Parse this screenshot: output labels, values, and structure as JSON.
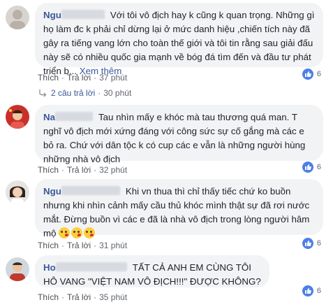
{
  "colors": {
    "link": "#385898",
    "bubble": "#f2f3f5",
    "like": "#4d7fe8",
    "meta": "#606770"
  },
  "comments": [
    {
      "name": "Ngu",
      "text": "Với tôi vô địch hay k cũng k quan trọng. Những gì họ làm đc k phải chỉ dừng lại ở mức danh hiệu ,chiến tích này đã gây ra tiếng vang lớn cho toàn thế giới và tôi tin rằng sau giải đấu này sẽ có nhiều quốc gia mạnh về bóg đá tìm đến và đầu tư phát triển b...",
      "see_more": "Xem thêm",
      "like": "Thích",
      "reply": "Trả lời",
      "time": "37 phút",
      "reaction_count": "6",
      "replies_label": "2 câu trả lời",
      "replies_time": "30 phút"
    },
    {
      "name": "Na",
      "text": "Tau nhìn mấy e khóc mà tau thương quá man. T nghĩ vô địch mới xứng đáng với công sức sự cố gắng mà các e bỏ ra. Chứ với dân tộc k có cup các e vẫn là những người hùng những nhà vô địch",
      "like": "Thích",
      "reply": "Trả lời",
      "time": "32 phút",
      "reaction_count": "6"
    },
    {
      "name": "Ngu",
      "text": "Khi vn thua thì chỉ thấy tiếc chứ ko buồn nhưng khi nhìn cảnh mấy cầu thủ khóc mình thật sự đã rơi nước mắt. Đừng buồn vì các e đã là nhà vô địch trong lòng người hâm mộ",
      "emojis": [
        "kissing-heart-emoji",
        "kissing-heart-emoji",
        "kissing-heart-emoji"
      ],
      "like": "Thích",
      "reply": "Trả lời",
      "time": "31 phút",
      "reaction_count": "6"
    },
    {
      "name": "Ho",
      "text": "TẤT CẢ ANH EM CÙNG TÔI HÔ VANG \"VIỆT NAM VÔ ĐỊCH!!!\" ĐƯỢC KHÔNG?",
      "like": "Thích",
      "reply": "Trả lời",
      "time": "35 phút",
      "reaction_count": "6"
    }
  ]
}
